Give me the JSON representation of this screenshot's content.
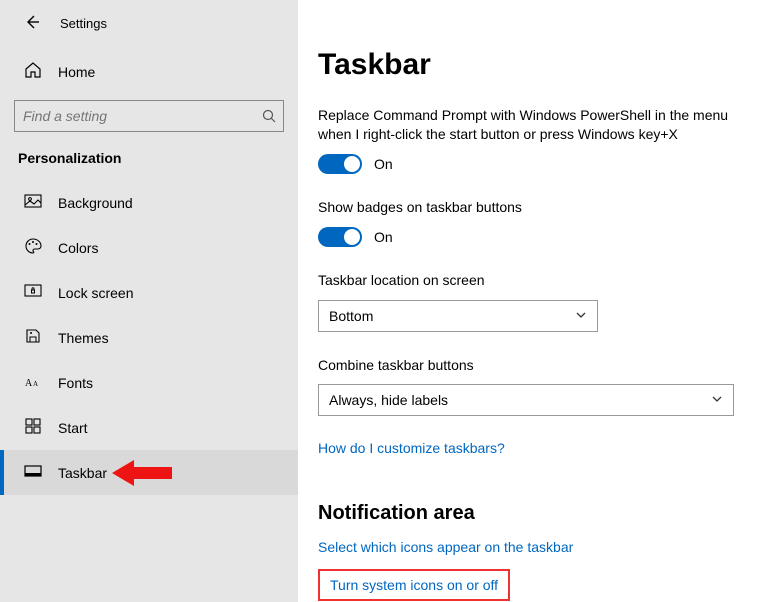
{
  "titlebar": {
    "title": "Settings"
  },
  "sidebar": {
    "home": "Home",
    "search_placeholder": "Find a setting",
    "section": "Personalization",
    "items": [
      {
        "label": "Background"
      },
      {
        "label": "Colors"
      },
      {
        "label": "Lock screen"
      },
      {
        "label": "Themes"
      },
      {
        "label": "Fonts"
      },
      {
        "label": "Start"
      },
      {
        "label": "Taskbar"
      }
    ]
  },
  "main": {
    "title": "Taskbar",
    "opt_powershell_label": "Replace Command Prompt with Windows PowerShell in the menu when I right-click the start button or press Windows key+X",
    "opt_powershell_state": "On",
    "opt_badges_label": "Show badges on taskbar buttons",
    "opt_badges_state": "On",
    "location_label": "Taskbar location on screen",
    "location_value": "Bottom",
    "combine_label": "Combine taskbar buttons",
    "combine_value": "Always, hide labels",
    "customize_link": "How do I customize taskbars?",
    "notif_heading": "Notification area",
    "link_select_icons": "Select which icons appear on the taskbar",
    "link_system_icons": "Turn system icons on or off"
  }
}
